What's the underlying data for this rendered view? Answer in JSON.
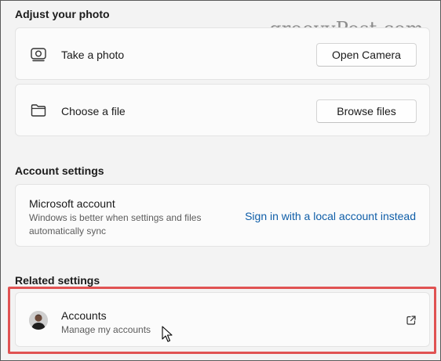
{
  "watermark": "groovyPost.com",
  "adjust_photo": {
    "heading": "Adjust your photo",
    "take_photo": {
      "label": "Take a photo",
      "icon": "camera-icon",
      "button": "Open Camera"
    },
    "choose_file": {
      "label": "Choose a file",
      "icon": "folder-icon",
      "button": "Browse files"
    }
  },
  "account_settings": {
    "heading": "Account settings",
    "microsoft_account": {
      "title": "Microsoft account",
      "description_line1": "Windows is better when settings and files",
      "description_line2": "automatically sync",
      "link": "Sign in with a local account instead"
    }
  },
  "related_settings": {
    "heading": "Related settings",
    "accounts": {
      "title": "Accounts",
      "subtitle": "Manage my accounts",
      "icon": "external-link-icon"
    }
  },
  "colors": {
    "accent_link": "#0f5ea8",
    "highlight": "#e05252",
    "background": "#f3f3f3"
  }
}
